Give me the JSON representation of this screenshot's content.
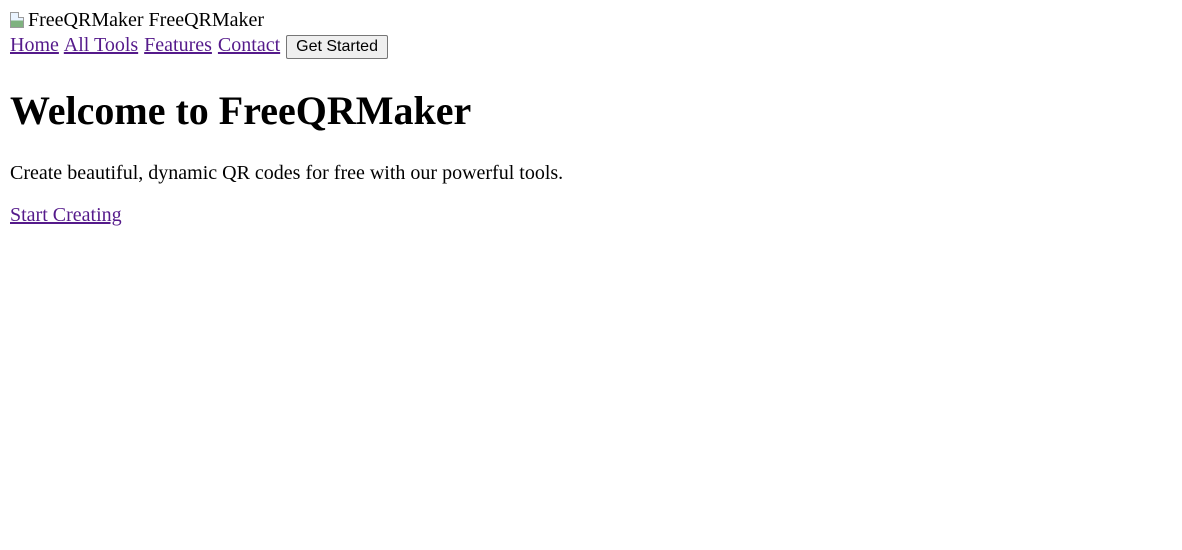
{
  "header": {
    "logo_alt": "FreeQRMaker",
    "brand_name": "FreeQRMaker"
  },
  "nav": {
    "items": [
      {
        "label": "Home"
      },
      {
        "label": "All Tools"
      },
      {
        "label": "Features"
      },
      {
        "label": "Contact"
      }
    ],
    "cta_label": "Get Started"
  },
  "hero": {
    "title": "Welcome to FreeQRMaker",
    "subtitle": "Create beautiful, dynamic QR codes for free with our powerful tools.",
    "link_label": "Start Creating"
  },
  "colors": {
    "link_visited": "#551a8b",
    "text": "#000000",
    "background": "#ffffff"
  },
  "icons": {
    "logo": "broken-image-icon"
  }
}
